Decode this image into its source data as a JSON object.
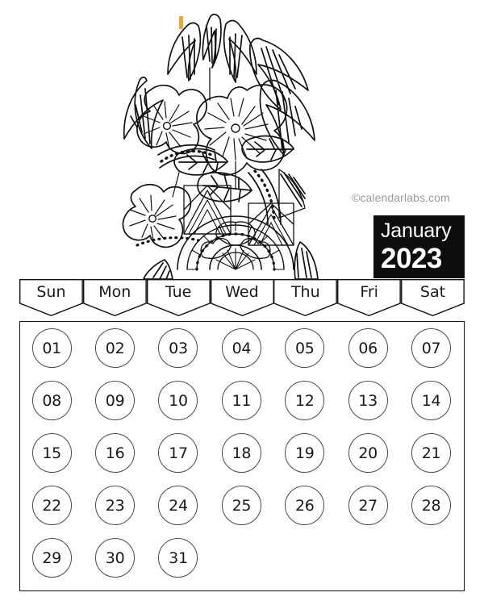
{
  "calendar": {
    "month": "January",
    "year": "2023",
    "watermark": "©calendarlabs.com",
    "weekdays": [
      {
        "label": "Sun"
      },
      {
        "label": "Mon"
      },
      {
        "label": "Tue"
      },
      {
        "label": "Wed"
      },
      {
        "label": "Thu"
      },
      {
        "label": "Fri"
      },
      {
        "label": "Sat"
      }
    ],
    "weeks": [
      [
        "01",
        "02",
        "03",
        "04",
        "05",
        "06",
        "07"
      ],
      [
        "08",
        "09",
        "10",
        "11",
        "12",
        "13",
        "14"
      ],
      [
        "15",
        "16",
        "17",
        "18",
        "19",
        "20",
        "21"
      ],
      [
        "22",
        "23",
        "24",
        "25",
        "26",
        "27",
        "28"
      ],
      [
        "29",
        "30",
        "31",
        "",
        "",
        "",
        ""
      ]
    ]
  },
  "illustration": {
    "name": "hibiscus-floral-line-art",
    "style": "black-and-white zentangle coloring page",
    "accent_color": "#e0a94a",
    "line_color": "#111111"
  },
  "colors": {
    "month_box_background": "#0d0d0d",
    "month_box_text": "#ffffff",
    "grid_border": "#111111",
    "circle_border": "#4a4a4a",
    "date_text": "#1a1a1a",
    "watermark_text": "#9a9a9a",
    "page_background": "#ffffff"
  }
}
